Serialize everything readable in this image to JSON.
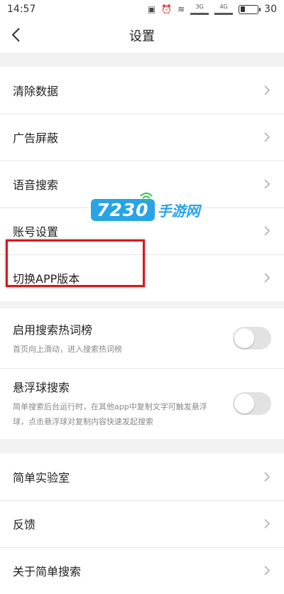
{
  "status_bar": {
    "time": "14:57",
    "network_3g": "3G",
    "network_4g": "4G",
    "battery": "30"
  },
  "header": {
    "title": "设置"
  },
  "group1": [
    {
      "label": "清除数据"
    },
    {
      "label": "广告屏蔽"
    },
    {
      "label": "语音搜索"
    },
    {
      "label": "账号设置"
    },
    {
      "label": "切换APP版本"
    }
  ],
  "group2": [
    {
      "label": "启用搜索热词榜",
      "desc": "首页向上滑动，进入搜索热词榜",
      "enabled": false
    },
    {
      "label": "悬浮球搜索",
      "desc": "简单搜索后台运行时，在其他app中复制文字可触发悬浮球，点击悬浮球对复制内容快速发起搜索",
      "enabled": false
    }
  ],
  "group3": [
    {
      "label": "简单实验室"
    },
    {
      "label": "反馈"
    },
    {
      "label": "关于简单搜索"
    }
  ],
  "watermark": {
    "number": "7230",
    "text": "手游网"
  },
  "colors": {
    "highlight": "#d9191f",
    "watermark": "#27a4e8"
  }
}
